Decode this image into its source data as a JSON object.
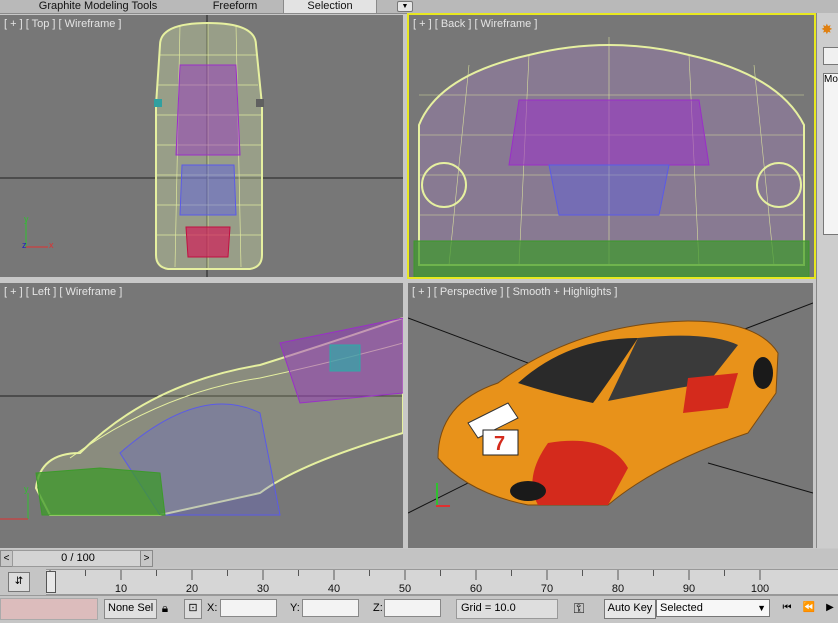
{
  "ribbon": {
    "tabs": [
      {
        "label": "Graphite Modeling Tools"
      },
      {
        "label": "Freeform"
      },
      {
        "label": "Selection"
      }
    ]
  },
  "viewports": {
    "top": {
      "label": "[ + ] [ Top ] [ Wireframe ]"
    },
    "back": {
      "label": "[ + ] [ Back ] [ Wireframe ]"
    },
    "left": {
      "label": "[ + ] [ Left ] [ Wireframe ]"
    },
    "perspective": {
      "label": "[ + ] [ Perspective ] [ Smooth + Highlights ]"
    }
  },
  "axes": {
    "x": "x",
    "y": "y",
    "z": "z"
  },
  "command_panel": {
    "field_text": "Mo",
    "icon": "sun-icon"
  },
  "timeline": {
    "frame_counter": "0 / 100",
    "prev_arrow": "<",
    "next_arrow": ">",
    "ticks": [
      "10",
      "20",
      "30",
      "40",
      "50",
      "60",
      "70",
      "80",
      "90",
      "100"
    ]
  },
  "status": {
    "selection_text": "None Sel",
    "x_label": "X:",
    "y_label": "Y:",
    "z_label": "Z:",
    "x_value": "",
    "y_value": "",
    "z_value": "",
    "grid": "Grid = 10.0",
    "auto_key": "Auto Key",
    "key_filter": "Selected"
  },
  "colors": {
    "viewport_bg": "#777777",
    "active_border": "#e8e820",
    "wire_yellow": "#e6f0a0",
    "wire_purple": "#9a2fc8",
    "wire_blue": "#5a5ae8",
    "wire_green": "#3c9a2a",
    "car_orange": "#e8921a",
    "car_red": "#d42a1c"
  }
}
